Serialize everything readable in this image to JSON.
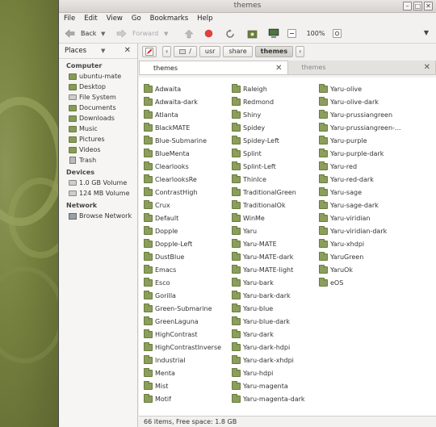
{
  "window": {
    "title": "themes"
  },
  "menubar": [
    "File",
    "Edit",
    "View",
    "Go",
    "Bookmarks",
    "Help"
  ],
  "toolbar": {
    "back": "Back",
    "forward": "Forward",
    "zoom": "100%"
  },
  "sidebar": {
    "header": "Places",
    "sections": [
      {
        "label": "Computer",
        "items": [
          {
            "label": "ubuntu-mate",
            "icon": "folder-icon"
          },
          {
            "label": "Desktop",
            "icon": "folder-icon"
          },
          {
            "label": "File System",
            "icon": "drive-icon"
          },
          {
            "label": "Documents",
            "icon": "folder-icon"
          },
          {
            "label": "Downloads",
            "icon": "folder-icon"
          },
          {
            "label": "Music",
            "icon": "folder-icon"
          },
          {
            "label": "Pictures",
            "icon": "folder-icon"
          },
          {
            "label": "Videos",
            "icon": "folder-icon"
          },
          {
            "label": "Trash",
            "icon": "trash-icon"
          }
        ]
      },
      {
        "label": "Devices",
        "items": [
          {
            "label": "1.0 GB Volume",
            "icon": "drive-icon"
          },
          {
            "label": "124 MB Volume",
            "icon": "drive-icon"
          }
        ]
      },
      {
        "label": "Network",
        "items": [
          {
            "label": "Browse Network",
            "icon": "network-icon"
          }
        ]
      }
    ]
  },
  "pathbar": [
    "/",
    "usr",
    "share",
    "themes"
  ],
  "tabs": [
    {
      "label": "themes",
      "active": true
    },
    {
      "label": "themes",
      "active": false
    }
  ],
  "columns": [
    [
      "Adwaita",
      "Adwaita-dark",
      "Atlanta",
      "BlackMATE",
      "Blue-Submarine",
      "BlueMenta",
      "Clearlooks",
      "ClearlooksRe",
      "ContrastHigh",
      "Crux",
      "Default",
      "Dopple",
      "Dopple-Left",
      "DustBlue",
      "Emacs",
      "Esco",
      "Gorilla",
      "Green-Submarine",
      "GreenLaguna",
      "HighContrast",
      "HighContrastInverse",
      "Industrial",
      "Menta",
      "Mist",
      "Motif"
    ],
    [
      "Raleigh",
      "Redmond",
      "Shiny",
      "Spidey",
      "Spidey-Left",
      "Splint",
      "Splint-Left",
      "ThinIce",
      "TraditionalGreen",
      "TraditionalOk",
      "WinMe",
      "Yaru",
      "Yaru-MATE",
      "Yaru-MATE-dark",
      "Yaru-MATE-light",
      "Yaru-bark",
      "Yaru-bark-dark",
      "Yaru-blue",
      "Yaru-blue-dark",
      "Yaru-dark",
      "Yaru-dark-hdpi",
      "Yaru-dark-xhdpi",
      "Yaru-hdpi",
      "Yaru-magenta",
      "Yaru-magenta-dark"
    ],
    [
      "Yaru-olive",
      "Yaru-olive-dark",
      "Yaru-prussiangreen",
      "Yaru-prussiangreen-...",
      "Yaru-purple",
      "Yaru-purple-dark",
      "Yaru-red",
      "Yaru-red-dark",
      "Yaru-sage",
      "Yaru-sage-dark",
      "Yaru-viridian",
      "Yaru-viridian-dark",
      "Yaru-xhdpi",
      "YaruGreen",
      "YaruOk",
      "eOS"
    ]
  ],
  "status": "66 items, Free space: 1.8 GB",
  "colors": {
    "folder": "#8c9e5b",
    "desktop": "#77823f"
  }
}
